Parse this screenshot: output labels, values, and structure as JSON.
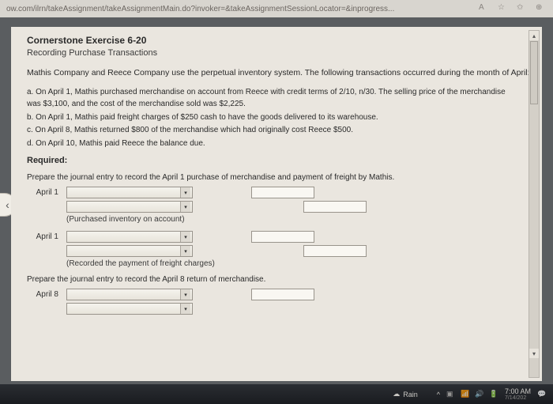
{
  "browser": {
    "url": "ow.com/ilrn/takeAssignment/takeAssignmentMain.do?invoker=&takeAssignmentSessionLocator=&inprogress..."
  },
  "exercise": {
    "title": "Cornerstone Exercise 6-20",
    "subtitle": "Recording Purchase Transactions",
    "intro": "Mathis Company and Reece Company use the perpetual inventory system. The following transactions occurred during the month of April:",
    "items": {
      "a": "a. On April 1, Mathis purchased merchandise on account from Reece with credit terms of 2/10, n/30. The selling price of the merchandise was $3,100, and the cost of the merchandise sold was $2,225.",
      "b": "b. On April 1, Mathis paid freight charges of $250 cash to have the goods delivered to its warehouse.",
      "c": "c. On April 8, Mathis returned $800 of the merchandise which had originally cost Reece $500.",
      "d": "d. On April 10, Mathis paid Reece the balance due."
    },
    "required_label": "Required:",
    "prep1": "Prepare the journal entry to record the April 1 purchase of merchandise and payment of freight by Mathis.",
    "dates": {
      "apr1": "April 1",
      "apr8": "April 8"
    },
    "note1": "(Purchased inventory on account)",
    "note2": "(Recorded the payment of freight charges)",
    "prep2": "Prepare the journal entry to record the April 8 return of merchandise."
  },
  "taskbar": {
    "weather": "Rain",
    "time": "7:00 AM",
    "date_partial": "7/14/202"
  }
}
